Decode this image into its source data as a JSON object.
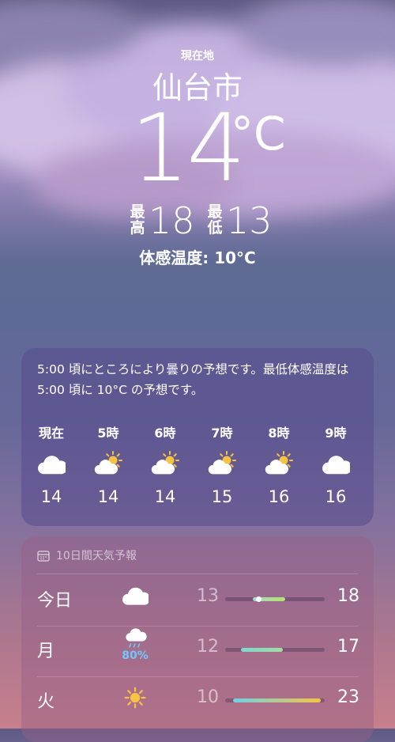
{
  "header": {
    "location_label": "現在地",
    "city": "仙台市",
    "temperature": "14",
    "unit": "°C",
    "high_label": "最高",
    "high": "18",
    "low_label": "最低",
    "low": "13",
    "feels_like": "体感温度: 10°C"
  },
  "hourly": {
    "summary": "5:00 頃にところにより曇りの予想です。最低体感温度は 5:00 頃に 10°C の予想です。",
    "items": [
      {
        "label": "現在",
        "icon": "cloud-icon",
        "temp": "14"
      },
      {
        "label": "5時",
        "icon": "partly-cloudy-icon",
        "temp": "14"
      },
      {
        "label": "6時",
        "icon": "partly-cloudy-icon",
        "temp": "14"
      },
      {
        "label": "7時",
        "icon": "partly-cloudy-icon",
        "temp": "15"
      },
      {
        "label": "8時",
        "icon": "partly-cloudy-icon",
        "temp": "16"
      },
      {
        "label": "9時",
        "icon": "cloud-icon",
        "temp": "16"
      }
    ]
  },
  "daily": {
    "title": "10日間天気予報",
    "days": [
      {
        "name": "今日",
        "icon": "cloud-icon",
        "precip": "",
        "low": "13",
        "high": "18",
        "range_start": 0.28,
        "range_end": 0.6,
        "current": 0.33,
        "colors": [
          "#9fd9c7",
          "#b7e26a"
        ]
      },
      {
        "name": "月",
        "icon": "rain-cloud-icon",
        "precip": "80%",
        "low": "12",
        "high": "17",
        "range_start": 0.16,
        "range_end": 0.58,
        "colors": [
          "#7ed6d3",
          "#a3dda2"
        ]
      },
      {
        "name": "火",
        "icon": "sun-icon",
        "precip": "",
        "low": "10",
        "high": "23",
        "range_start": 0.08,
        "range_end": 0.96,
        "colors": [
          "#6fd1e3",
          "#f5c542"
        ]
      }
    ]
  }
}
